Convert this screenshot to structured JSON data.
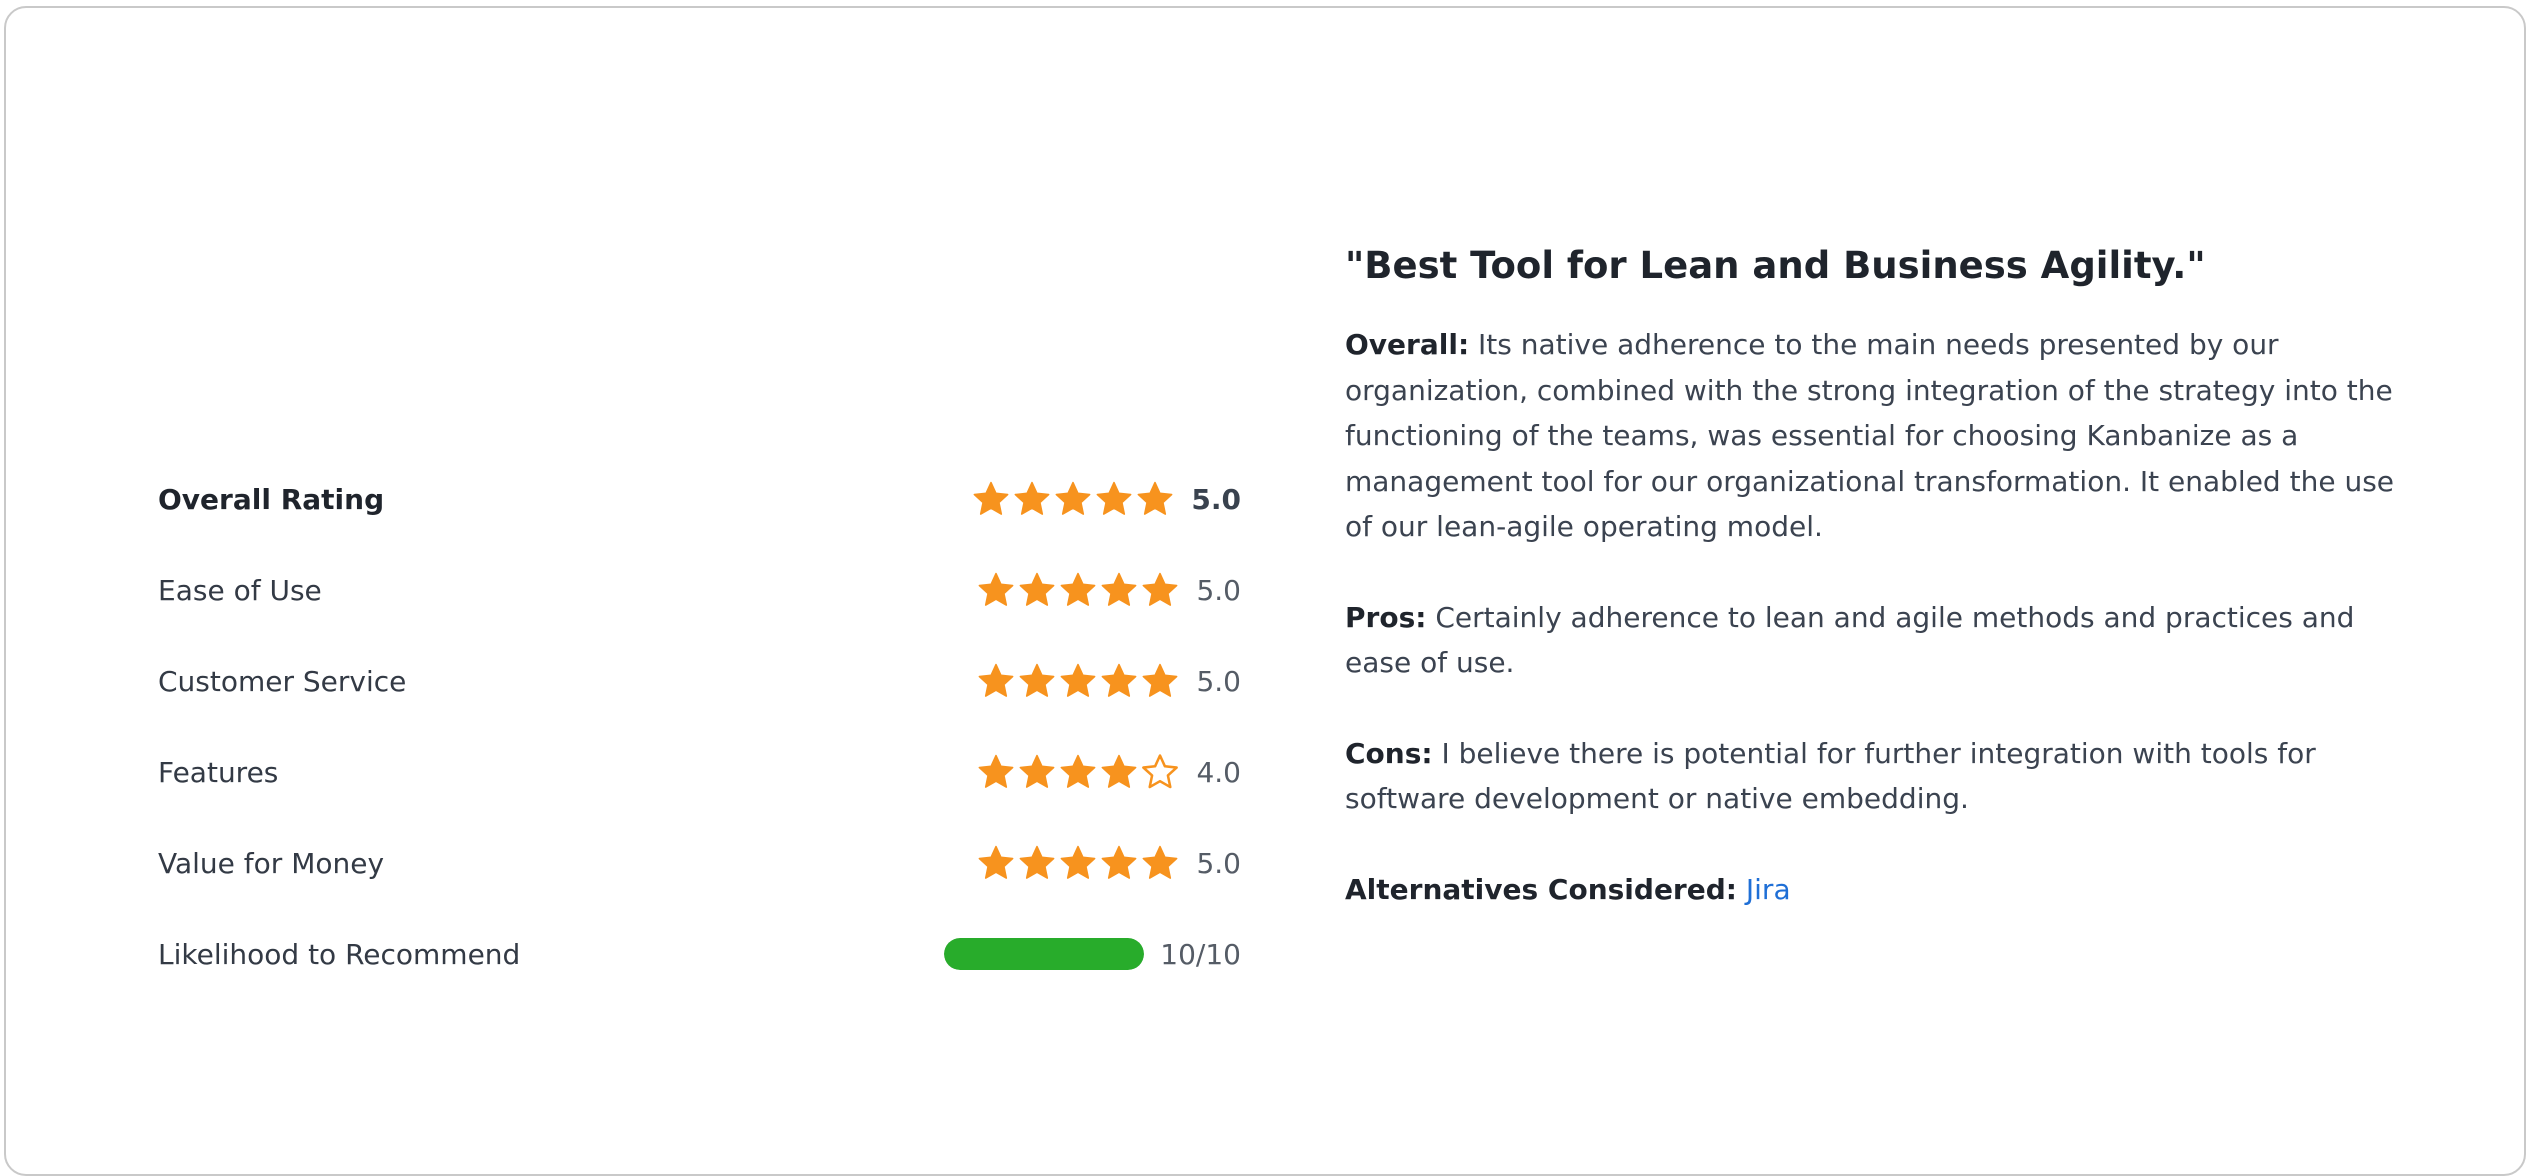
{
  "ratings": [
    {
      "label": "Overall Rating",
      "score": "5.0",
      "stars": 5,
      "bold": true
    },
    {
      "label": "Ease of Use",
      "score": "5.0",
      "stars": 5,
      "bold": false
    },
    {
      "label": "Customer Service",
      "score": "5.0",
      "stars": 5,
      "bold": false
    },
    {
      "label": "Features",
      "score": "4.0",
      "stars": 4,
      "bold": false
    },
    {
      "label": "Value for Money",
      "score": "5.0",
      "stars": 5,
      "bold": false
    }
  ],
  "recommend": {
    "label": "Likelihood to Recommend",
    "score": "10/10",
    "value": 10,
    "max": 10,
    "color": "#28ac2b"
  },
  "review": {
    "title": "\"Best Tool for Lean and Business Agility.\"",
    "overall_label": "Overall:",
    "overall_text": " Its native adherence to the main needs presented by our organization, combined with the strong integration of the strategy into the functioning of the teams, was essential for choosing Kanbanize as a management tool for our organizational transformation. It enabled the use of our lean-agile operating model.",
    "pros_label": "Pros:",
    "pros_text": " Certainly adherence to lean and agile methods and practices and ease of use.",
    "cons_label": "Cons:",
    "cons_text": " I believe there is potential for further integration with tools for software development or native embedding.",
    "alternatives_label": "Alternatives Considered:",
    "alternatives_link": "Jira"
  },
  "colors": {
    "star": "#f7931e",
    "link": "#1f6fd6"
  },
  "icons": {
    "filled_star": "star-icon",
    "empty_star": "star-outline-icon"
  }
}
